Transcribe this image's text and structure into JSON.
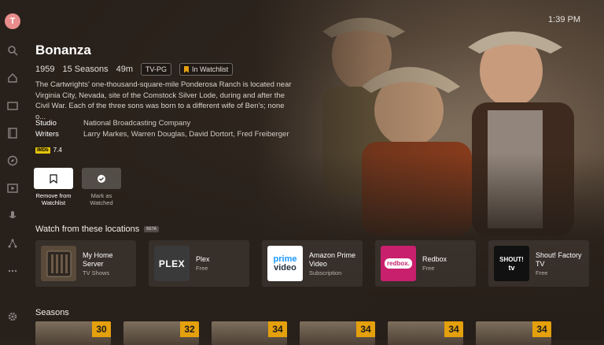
{
  "user": {
    "initial": "T"
  },
  "clock": "1:39 PM",
  "rail": {
    "icons": [
      "search-icon",
      "home-icon",
      "tv-icon",
      "film-icon",
      "compass-icon",
      "play-icon",
      "microphone-icon",
      "network-icon",
      "more-icon",
      "settings-icon"
    ]
  },
  "show": {
    "title": "Bonanza",
    "year": "1959",
    "seasons": "15 Seasons",
    "runtime": "49m",
    "rating_badge": "TV-PG",
    "watchlist_badge": "In Watchlist",
    "summary": "The Cartwrights' one-thousand-square-mile Ponderosa Ranch is located near Virginia City, Nevada, site of the Comstock Silver Lode, during and after the Civil War. Each of the three sons was born to a different wife of Ben's; none o...",
    "studio_label": "Studio",
    "studio": "National Broadcasting Company",
    "writers_label": "Writers",
    "writers": "Larry Markes, Warren Douglas, David Dortort, Fred Freiberger",
    "imdb_label": "IMDb",
    "imdb_rating": "7.4"
  },
  "actions": {
    "watchlist_label": "Remove from Watchlist",
    "watched_label": "Mark as Watched"
  },
  "locations_section": {
    "title": "Watch from these locations",
    "beta": "BETA",
    "items": [
      {
        "name": "My Home Server",
        "sub": "TV Shows"
      },
      {
        "name": "Plex",
        "sub": "Free",
        "logo_text": "PLEX"
      },
      {
        "name": "Amazon Prime Video",
        "sub": "Subscription",
        "logo_line1": "prime",
        "logo_line2": "video"
      },
      {
        "name": "Redbox",
        "sub": "Free",
        "logo_text": "redbox."
      },
      {
        "name": "Shout! Factory TV",
        "sub": "Free",
        "logo_line1": "SHOUT!",
        "logo_line2": "tv"
      }
    ]
  },
  "seasons_section": {
    "title": "Seasons",
    "counts": [
      "30",
      "32",
      "34",
      "34",
      "34",
      "34"
    ]
  },
  "colors": {
    "accent": "#e5a00d",
    "background": "#2a231d"
  }
}
